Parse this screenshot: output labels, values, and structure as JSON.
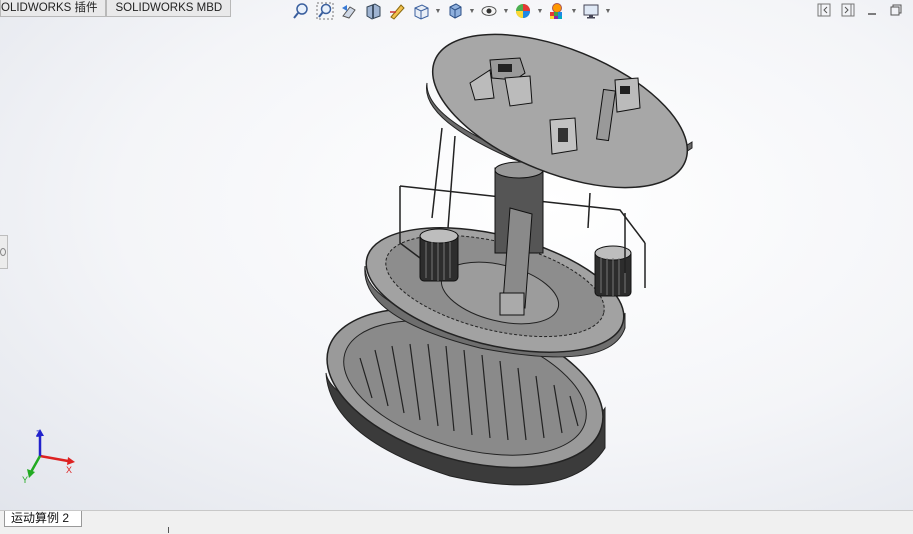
{
  "tabs": [
    {
      "label": "OLIDWORKS 插件"
    },
    {
      "label": "SOLIDWORKS MBD"
    }
  ],
  "toolbar": {
    "icons": [
      "zoom-to-fit-icon",
      "zoom-to-area-icon",
      "previous-view-icon",
      "section-view-icon",
      "dynamic-annotation-icon",
      "view-orientation-icon",
      "display-style-icon",
      "hide-show-items-icon",
      "edit-appearance-icon",
      "apply-scene-icon",
      "view-settings-icon"
    ]
  },
  "triad": {
    "x_label": "X",
    "y_label": "Y",
    "z_label": "Z"
  },
  "bottom": {
    "tab_label": "运动算例 2"
  },
  "colors": {
    "viewport_edge": "#e2e5ec",
    "part_gray": "#8e8e8e",
    "base_dark": "#3b3b3b",
    "triad_x": "#d22",
    "triad_y": "#2a2",
    "triad_z": "#22c"
  }
}
